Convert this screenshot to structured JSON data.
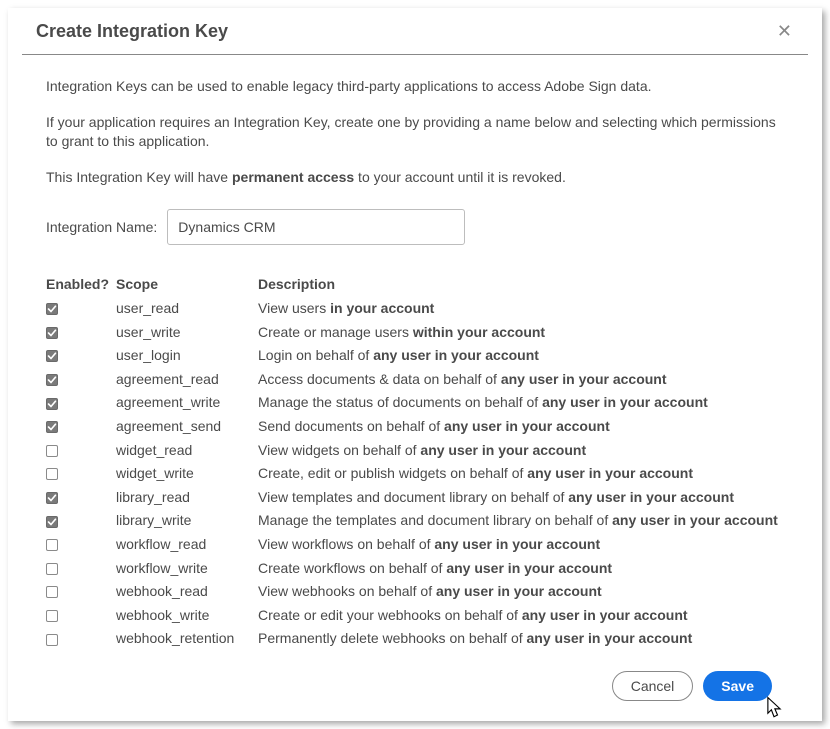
{
  "header": {
    "title": "Create Integration Key"
  },
  "intro": {
    "p1": "Integration Keys can be used to enable legacy third-party applications to access Adobe Sign data.",
    "p2": "If your application requires an Integration Key, create one by providing a name below and selecting which permissions to grant to this application.",
    "p3_prefix": "This Integration Key will have ",
    "p3_bold": "permanent access",
    "p3_suffix": " to your account until it is revoked."
  },
  "name_field": {
    "label": "Integration Name:",
    "value": "Dynamics CRM"
  },
  "columns": {
    "enabled": "Enabled?",
    "scope": "Scope",
    "description": "Description"
  },
  "permissions": [
    {
      "checked": true,
      "scope": "user_read",
      "desc_prefix": "View users ",
      "desc_bold": "in your account"
    },
    {
      "checked": true,
      "scope": "user_write",
      "desc_prefix": "Create or manage users ",
      "desc_bold": "within your account"
    },
    {
      "checked": true,
      "scope": "user_login",
      "desc_prefix": "Login on behalf of ",
      "desc_bold": "any user in your account"
    },
    {
      "checked": true,
      "scope": "agreement_read",
      "desc_prefix": "Access documents & data on behalf of ",
      "desc_bold": "any user in your account"
    },
    {
      "checked": true,
      "scope": "agreement_write",
      "desc_prefix": "Manage the status of documents on behalf of ",
      "desc_bold": "any user in your account"
    },
    {
      "checked": true,
      "scope": "agreement_send",
      "desc_prefix": "Send documents on behalf of ",
      "desc_bold": "any user in your account"
    },
    {
      "checked": false,
      "scope": "widget_read",
      "desc_prefix": "View widgets on behalf of ",
      "desc_bold": "any user in your account"
    },
    {
      "checked": false,
      "scope": "widget_write",
      "desc_prefix": "Create, edit or publish widgets on behalf of ",
      "desc_bold": "any user in your account"
    },
    {
      "checked": true,
      "scope": "library_read",
      "desc_prefix": "View templates and document library on behalf of ",
      "desc_bold": "any user in your account"
    },
    {
      "checked": true,
      "scope": "library_write",
      "desc_prefix": "Manage the templates and document library on behalf of ",
      "desc_bold": "any user in your account"
    },
    {
      "checked": false,
      "scope": "workflow_read",
      "desc_prefix": "View workflows on behalf of ",
      "desc_bold": "any user in your account"
    },
    {
      "checked": false,
      "scope": "workflow_write",
      "desc_prefix": "Create workflows on behalf of ",
      "desc_bold": "any user in your account"
    },
    {
      "checked": false,
      "scope": "webhook_read",
      "desc_prefix": "View webhooks on behalf of ",
      "desc_bold": "any user in your account"
    },
    {
      "checked": false,
      "scope": "webhook_write",
      "desc_prefix": "Create or edit your webhooks on behalf of ",
      "desc_bold": "any user in your account"
    },
    {
      "checked": false,
      "scope": "webhook_retention",
      "desc_prefix": "Permanently delete webhooks on behalf of ",
      "desc_bold": "any user in your account"
    }
  ],
  "buttons": {
    "cancel": "Cancel",
    "save": "Save"
  }
}
